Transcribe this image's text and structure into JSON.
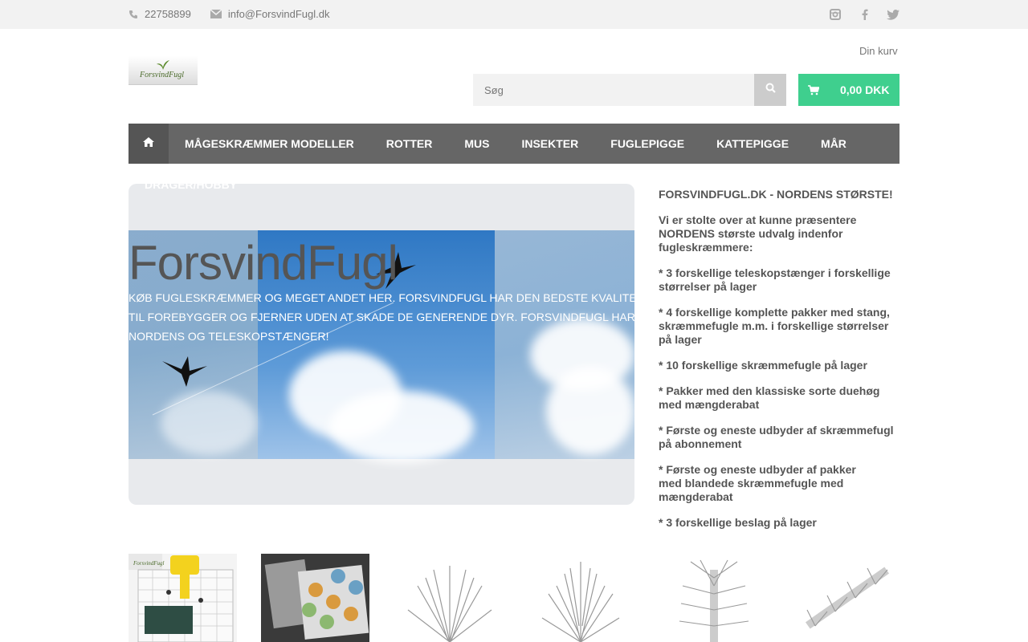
{
  "topbar": {
    "phone": "22758899",
    "email": "info@ForsvindFugl.dk",
    "icons": [
      "phone-icon",
      "mail-icon",
      "instagram-icon",
      "facebook-icon",
      "twitter-icon"
    ]
  },
  "header": {
    "logo_text": "ForsvindFugl",
    "cart_label": "Din kurv",
    "search_placeholder": "Søg",
    "cart_total": "0,00 DKK"
  },
  "nav": {
    "items": [
      "MÅGESKRÆMMER MODELLER",
      "ROTTER",
      "MUS",
      "INSEKTER",
      "FUGLEPIGGE",
      "KATTEPIGGE",
      "MÅR"
    ],
    "overflow_item": "DRAGER/HOBBY"
  },
  "hero": {
    "title": "ForsvindFugl",
    "description": "KØB FUGLESKRÆMMER OG MEGET ANDET HER. FORSVINDFUGL HAR DEN BEDSTE KVALITET TIL FOREBYGGER OG FJERNER UDEN AT SKADE DE GENERENDE DYR. FORSVINDFUGL HAR NORDENS OG TELESKOPSTÆNGER!"
  },
  "info": {
    "heading": "FORSVINDFUGL.DK - NORDENS STØRSTE!",
    "paragraphs": [
      "Vi er stolte over at kunne præsentere NORDENS største udvalg indenfor fugleskræmmere:",
      "* 3 forskellige teleskopstænger i forskellige størrelser på lager",
      "* 4 forskellige komplette pakker med stang, skræmmefugle m.m. i forskellige størrelser på lager",
      "* 10 forskellige skræmmefugle på lager",
      "* Pakker med den klassiske sorte duehøg med mængderabat",
      "* Første og eneste udbyder af skræmmefugl på abonnement",
      "* Første og eneste udbyder af pakker med blandede skræmmefugle med mængderabat",
      "* 3 forskellige beslag på lager"
    ]
  },
  "colors": {
    "accent_green": "#3fcf8e",
    "nav_bg": "#666666",
    "topbar_bg": "#f2f2f2"
  }
}
